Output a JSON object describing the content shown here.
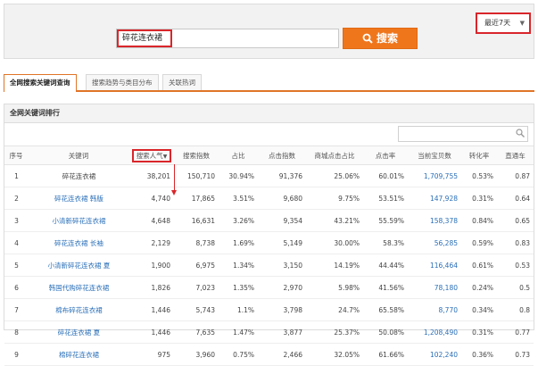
{
  "top": {
    "range_label": "最近7天",
    "search_value": "碎花连衣裙",
    "search_button": "搜索"
  },
  "tabs": [
    {
      "label": "全网搜索关键词查询"
    },
    {
      "label": "搜索趋势与类目分布"
    },
    {
      "label": "关联热词"
    }
  ],
  "section": {
    "title": "全网关键词排行"
  },
  "table": {
    "headers": [
      "序号",
      "关键词",
      "搜索人气",
      "搜索指数",
      "占比",
      "点击指数",
      "商城点击占比",
      "点击率",
      "当前宝贝数",
      "转化率",
      "直通车"
    ],
    "rows": [
      {
        "no": "1",
        "kw": "碎花连衣裙",
        "pop": "38,201",
        "idx": "150,710",
        "share": "30.94%",
        "click": "91,376",
        "mall": "25.06%",
        "ctr": "60.01%",
        "items": "1,709,755",
        "conv": "0.53%",
        "ztc": "0.87"
      },
      {
        "no": "2",
        "kw": "碎花连衣裙 韩版",
        "pop": "4,740",
        "idx": "17,865",
        "share": "3.51%",
        "click": "9,680",
        "mall": "9.75%",
        "ctr": "53.51%",
        "items": "147,928",
        "conv": "0.31%",
        "ztc": "0.64"
      },
      {
        "no": "3",
        "kw": "小清新碎花连衣裙",
        "pop": "4,648",
        "idx": "16,631",
        "share": "3.26%",
        "click": "9,354",
        "mall": "43.21%",
        "ctr": "55.59%",
        "items": "158,378",
        "conv": "0.84%",
        "ztc": "0.65"
      },
      {
        "no": "4",
        "kw": "碎花连衣裙 长袖",
        "pop": "2,129",
        "idx": "8,738",
        "share": "1.69%",
        "click": "5,149",
        "mall": "30.00%",
        "ctr": "58.3%",
        "items": "56,285",
        "conv": "0.59%",
        "ztc": "0.83"
      },
      {
        "no": "5",
        "kw": "小清新碎花连衣裙 夏",
        "pop": "1,900",
        "idx": "6,975",
        "share": "1.34%",
        "click": "3,150",
        "mall": "14.19%",
        "ctr": "44.44%",
        "items": "116,464",
        "conv": "0.61%",
        "ztc": "0.53"
      },
      {
        "no": "6",
        "kw": "韩国代购碎花连衣裙",
        "pop": "1,826",
        "idx": "7,023",
        "share": "1.35%",
        "click": "2,970",
        "mall": "5.98%",
        "ctr": "41.56%",
        "items": "78,180",
        "conv": "0.24%",
        "ztc": "0.5"
      },
      {
        "no": "7",
        "kw": "棉布碎花连衣裙",
        "pop": "1,446",
        "idx": "5,743",
        "share": "1.1%",
        "click": "3,798",
        "mall": "24.7%",
        "ctr": "65.58%",
        "items": "8,770",
        "conv": "0.34%",
        "ztc": "0.8"
      },
      {
        "no": "8",
        "kw": "碎花连衣裙 夏",
        "pop": "1,446",
        "idx": "7,635",
        "share": "1.47%",
        "click": "3,877",
        "mall": "25.37%",
        "ctr": "50.08%",
        "items": "1,208,490",
        "conv": "0.31%",
        "ztc": "0.77"
      },
      {
        "no": "9",
        "kw": "棉碎花连衣裙",
        "pop": "975",
        "idx": "3,960",
        "share": "0.75%",
        "click": "2,466",
        "mall": "32.05%",
        "ctr": "61.66%",
        "items": "102,240",
        "conv": "0.36%",
        "ztc": "0.73"
      }
    ]
  },
  "colors": {
    "accent": "#f0761c",
    "highlight": "#d9262b",
    "link": "#2a6fb8"
  },
  "icons": {
    "search_button_icon": "search-icon",
    "table_search_icon": "search-icon",
    "dropdown_icon": "caret-down-icon"
  }
}
